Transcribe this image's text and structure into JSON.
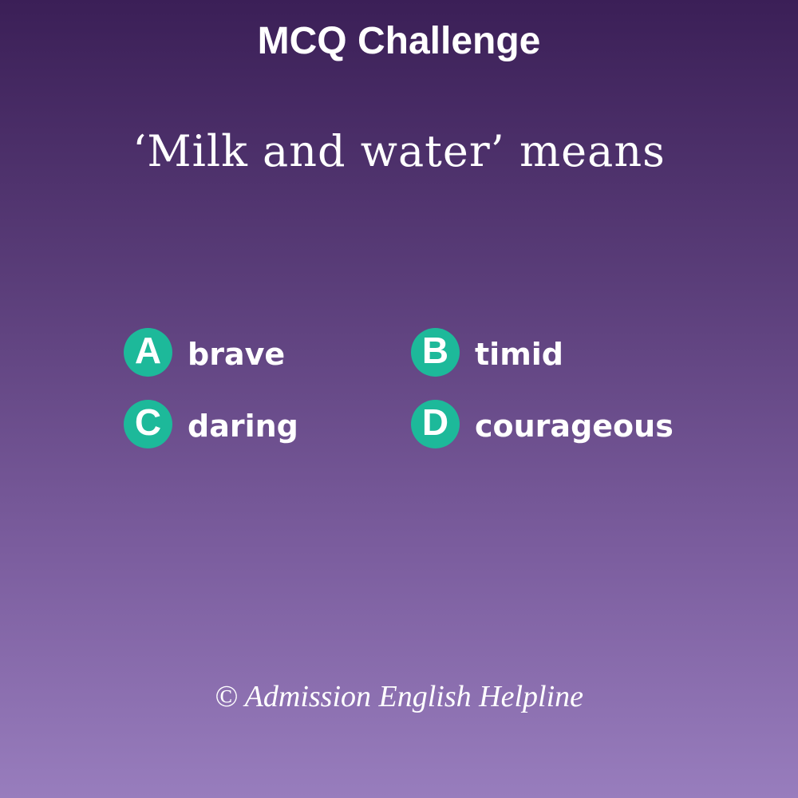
{
  "header": {
    "title": "MCQ Challenge"
  },
  "question": {
    "text": "‘Milk and water’ means"
  },
  "options": [
    {
      "letter": "A",
      "text": "brave"
    },
    {
      "letter": "B",
      "text": "timid"
    },
    {
      "letter": "C",
      "text": "daring"
    },
    {
      "letter": "D",
      "text": "courageous"
    }
  ],
  "footer": {
    "copyright": "© Admission English Helpline"
  },
  "colors": {
    "background_top": "#3b1f57",
    "background_bottom": "#987dbd",
    "badge": "#1db99a",
    "text": "#ffffff"
  }
}
